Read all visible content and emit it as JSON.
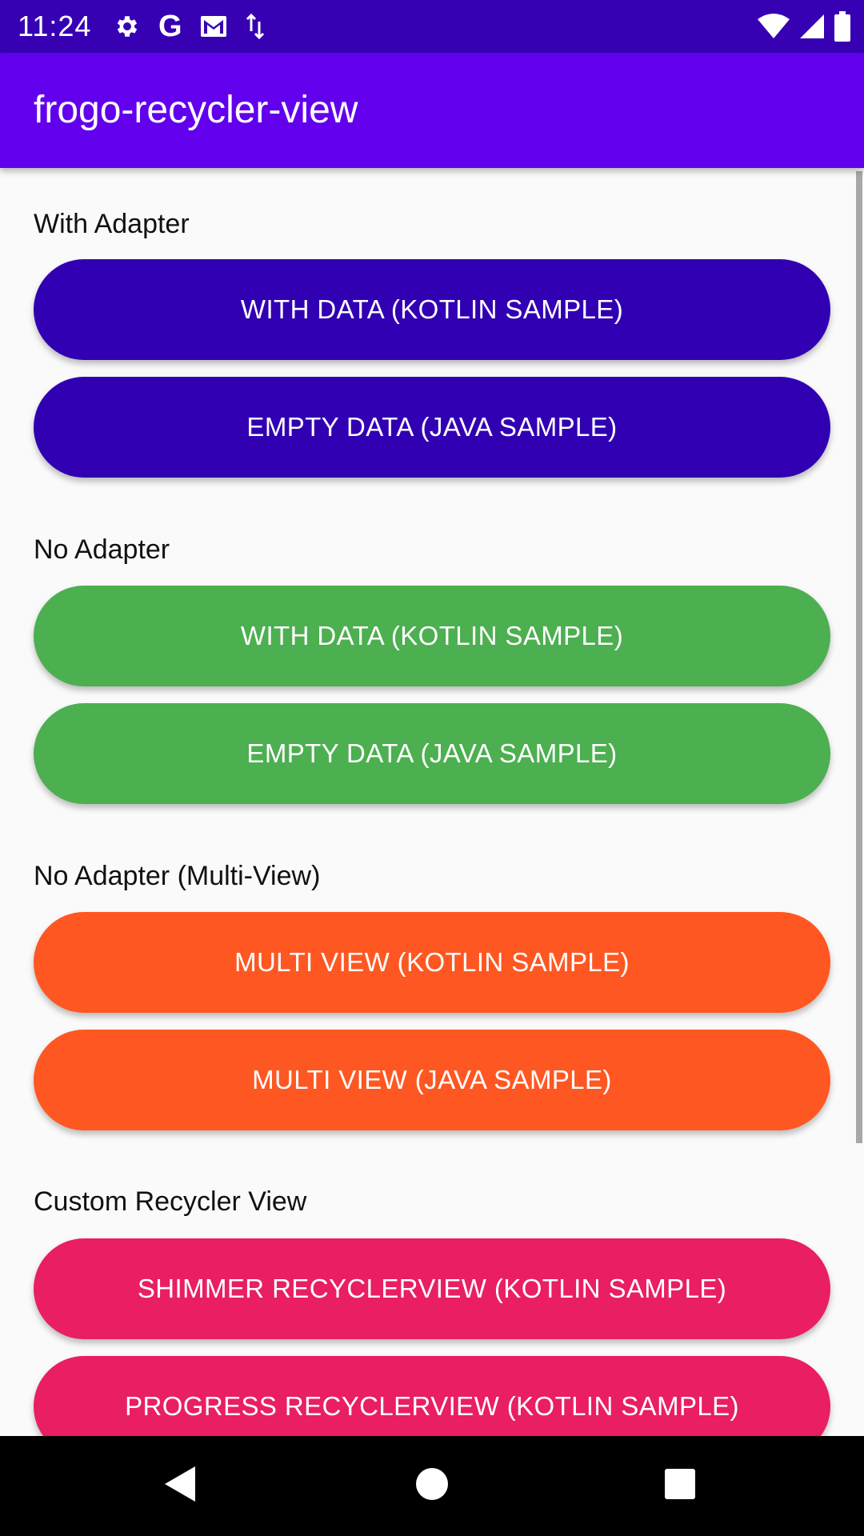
{
  "status_bar": {
    "time": "11:24",
    "left_icons": [
      "gear-icon",
      "google-icon",
      "gmail-icon",
      "data-transfer-icon"
    ],
    "right_icons": [
      "wifi-icon",
      "cell-signal-icon",
      "battery-icon"
    ],
    "google_glyph": "G"
  },
  "app_bar": {
    "title": "frogo-recycler-view"
  },
  "sections": [
    {
      "label": "With Adapter",
      "buttons": [
        "WITH DATA (KOTLIN SAMPLE)",
        "EMPTY DATA (JAVA SAMPLE)"
      ],
      "color": "#3100b2"
    },
    {
      "label": "No Adapter",
      "buttons": [
        "WITH DATA (KOTLIN SAMPLE)",
        "EMPTY DATA (JAVA SAMPLE)"
      ],
      "color": "#4caf50"
    },
    {
      "label": "No Adapter (Multi-View)",
      "buttons": [
        "MULTI VIEW (KOTLIN SAMPLE)",
        "MULTI VIEW (JAVA SAMPLE)"
      ],
      "color": "#ff5722"
    },
    {
      "label": "Custom Recycler View",
      "buttons": [
        "SHIMMER RECYCLERVIEW (KOTLIN SAMPLE)",
        "PROGRESS RECYCLERVIEW (KOTLIN SAMPLE)"
      ],
      "color": "#e91e63"
    }
  ],
  "nav_bar": {
    "buttons": [
      "back-icon",
      "home-icon",
      "recents-icon"
    ]
  },
  "colors": {
    "status_bar": "#3700b3",
    "app_bar": "#6200ee",
    "background": "#fafafa"
  }
}
